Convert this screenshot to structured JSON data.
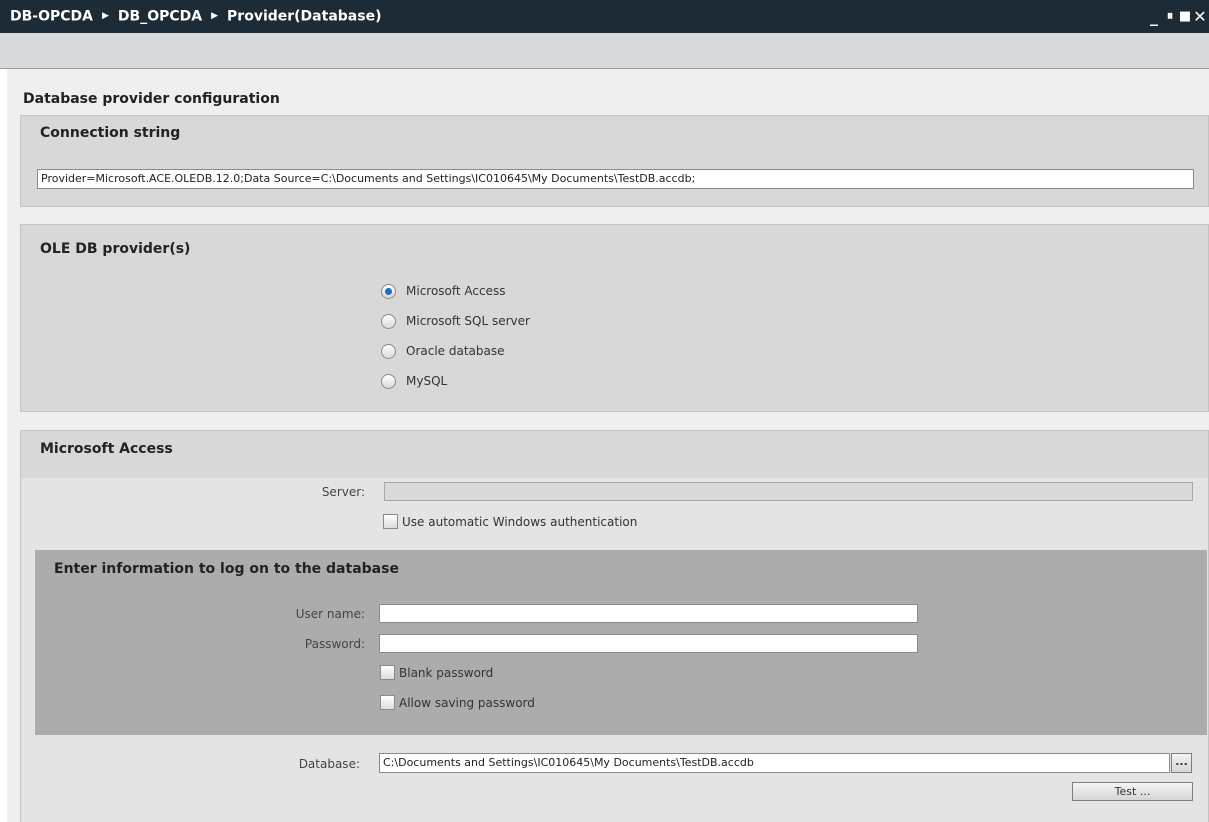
{
  "window": {
    "breadcrumb": [
      "DB-OPCDA",
      "DB_OPCDA",
      "Provider(Database)"
    ],
    "controls": {
      "minimize": "_",
      "split": "⏸",
      "maximize": "■",
      "close": "✕"
    }
  },
  "page": {
    "title": "Database provider configuration"
  },
  "connection": {
    "title": "Connection string",
    "value": "Provider=Microsoft.ACE.OLEDB.12.0;Data Source=C:\\Documents and Settings\\IC010645\\My Documents\\TestDB.accdb;"
  },
  "providers": {
    "title": "OLE DB provider(s)",
    "options": [
      "Microsoft Access",
      "Microsoft SQL server",
      "Oracle database",
      "MySQL"
    ],
    "selected": "Microsoft Access"
  },
  "access": {
    "title": "Microsoft Access",
    "server_label": "Server:",
    "server_value": "",
    "auto_auth_label": "Use automatic Windows authentication",
    "login": {
      "title": "Enter information to log on to the database",
      "username_label": "User name:",
      "username_value": "",
      "password_label": "Password:",
      "password_value": "",
      "blank_password_label": "Blank password",
      "allow_saving_label": "Allow saving password"
    },
    "database_label": "Database:",
    "database_value": "C:\\Documents and Settings\\IC010645\\My Documents\\TestDB.accdb",
    "browse_label": "...",
    "test_label": "Test ..."
  }
}
